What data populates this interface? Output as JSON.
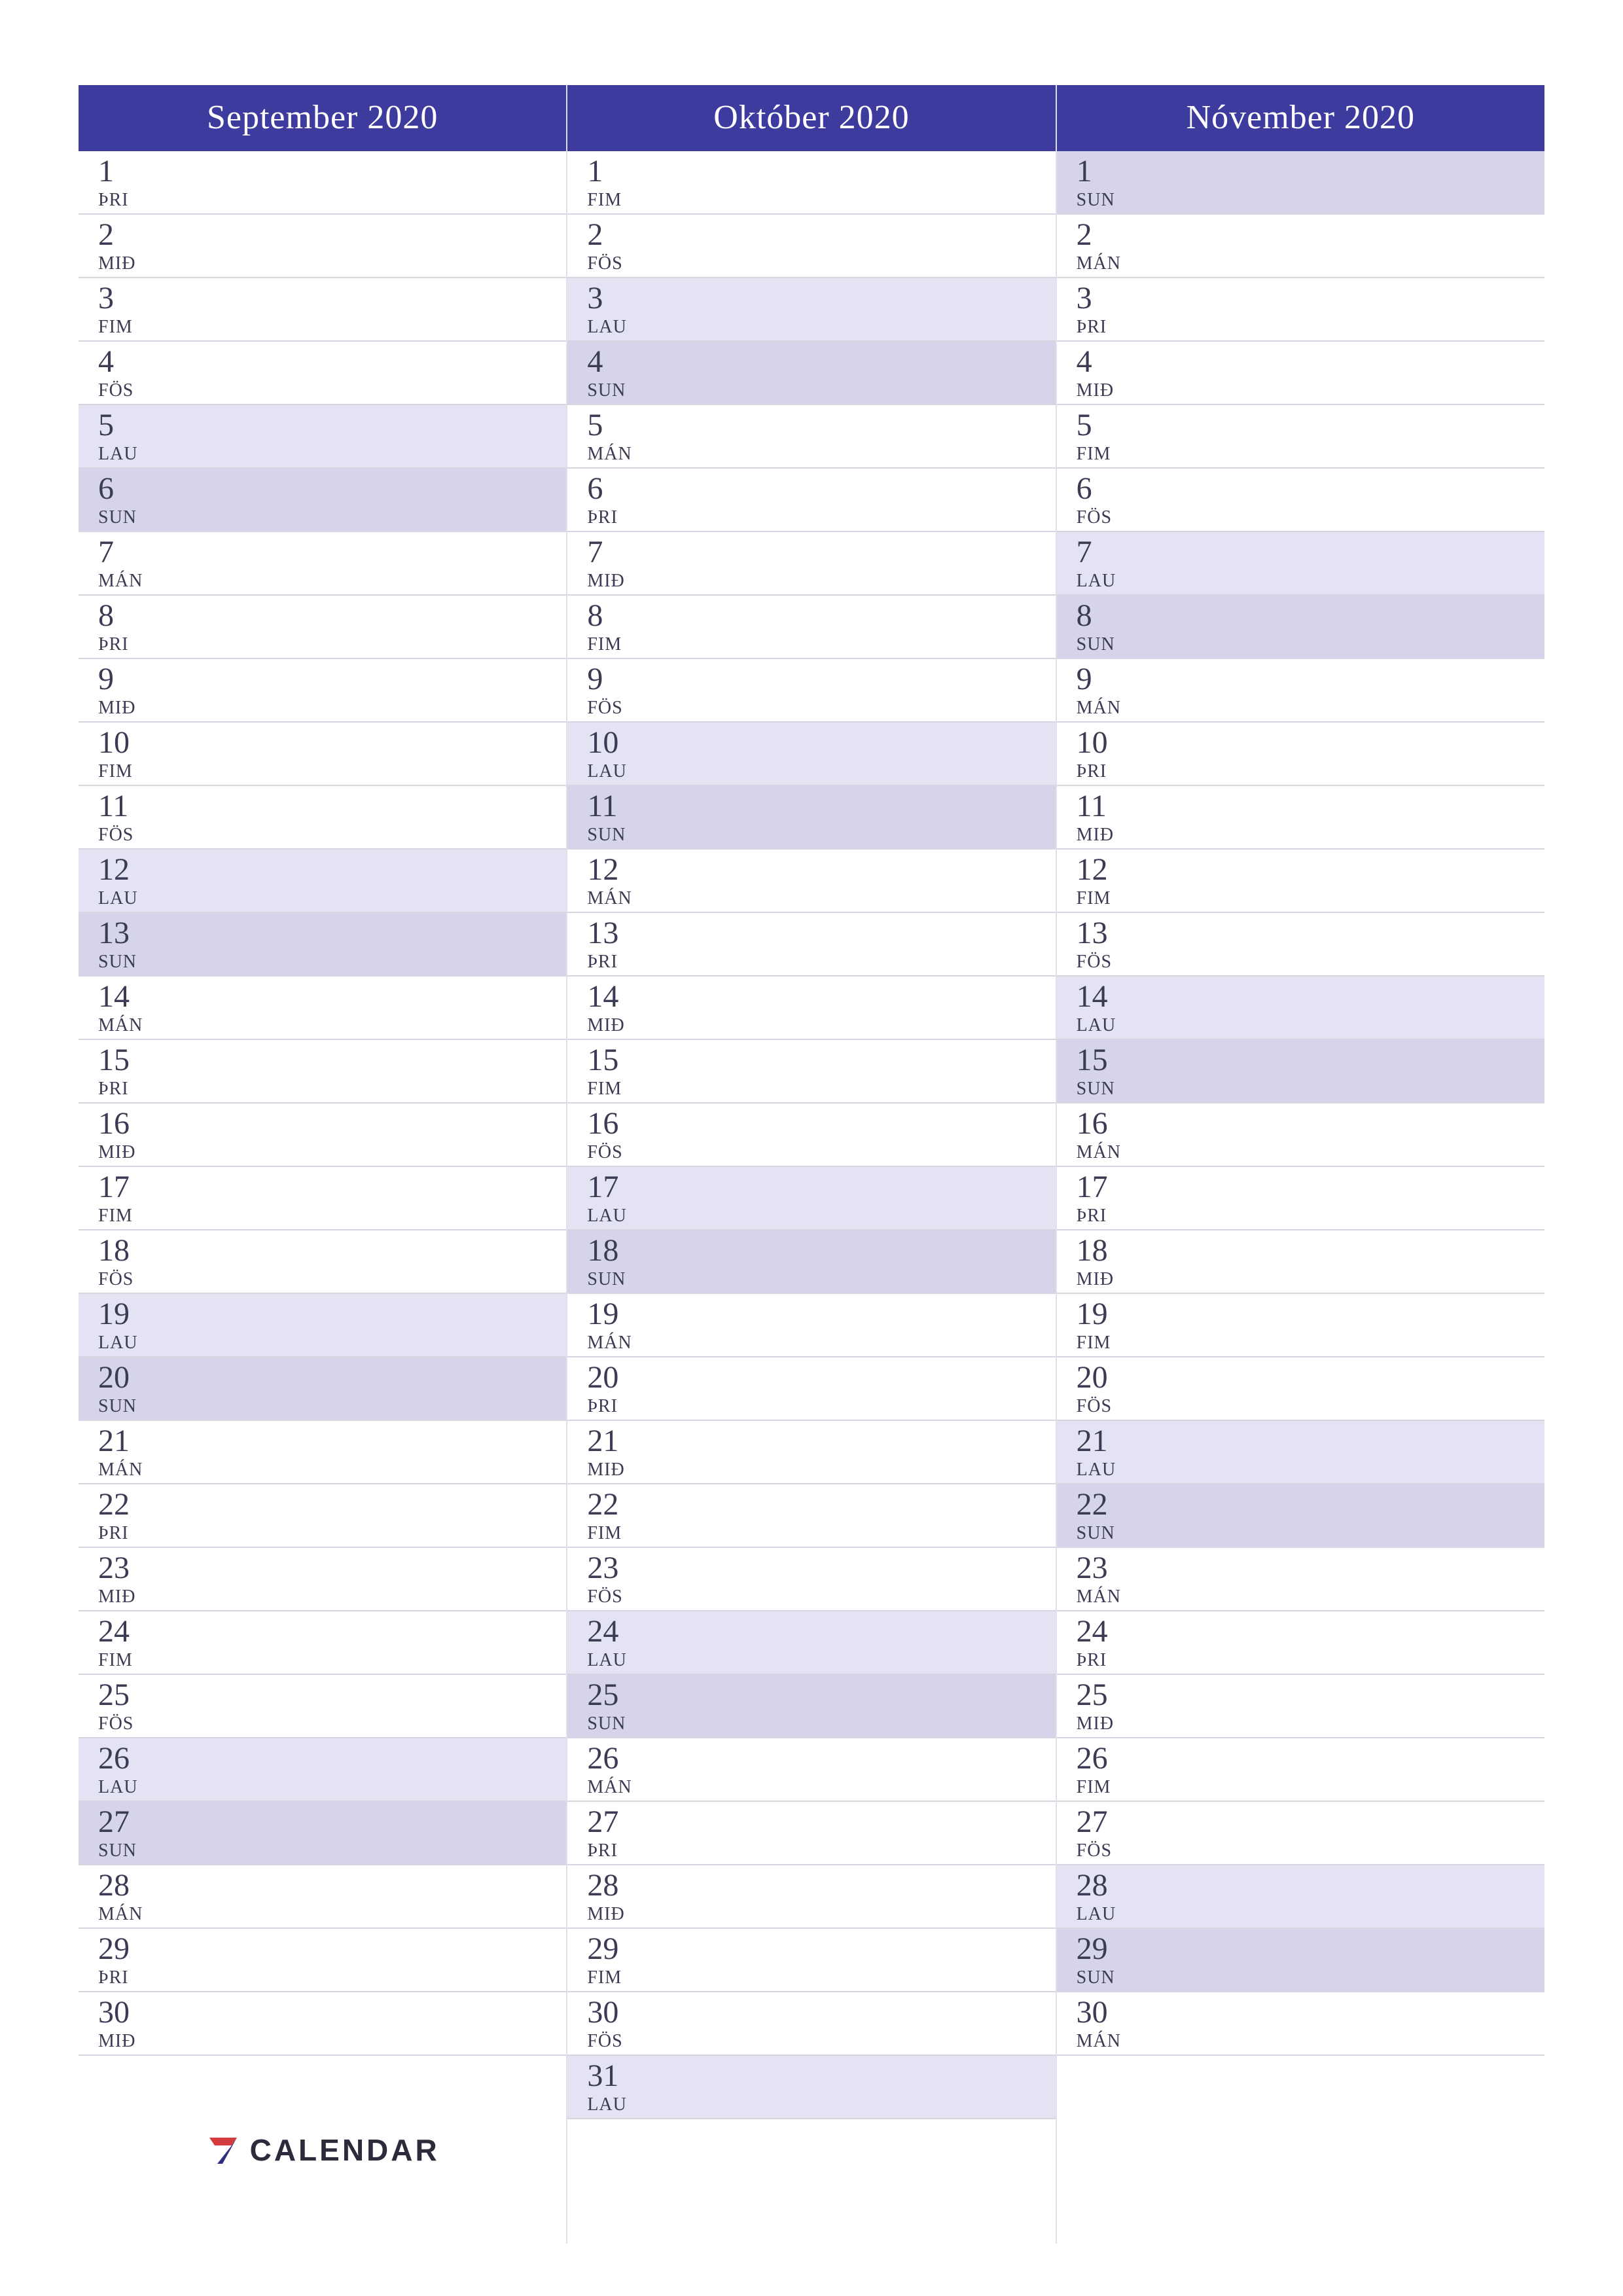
{
  "dayAbbr": {
    "MAN": "MÁN",
    "THRI": "ÞRI",
    "MID": "MIÐ",
    "FIM": "FIM",
    "FOS": "FÖS",
    "LAU": "LAU",
    "SUN": "SUN"
  },
  "brand": {
    "text": "CALENDAR"
  },
  "columns": [
    {
      "title": "September 2020",
      "days": [
        {
          "n": 1,
          "d": "THRI",
          "t": "weekday"
        },
        {
          "n": 2,
          "d": "MID",
          "t": "weekday"
        },
        {
          "n": 3,
          "d": "FIM",
          "t": "weekday"
        },
        {
          "n": 4,
          "d": "FOS",
          "t": "weekday"
        },
        {
          "n": 5,
          "d": "LAU",
          "t": "sat"
        },
        {
          "n": 6,
          "d": "SUN",
          "t": "sun"
        },
        {
          "n": 7,
          "d": "MAN",
          "t": "weekday"
        },
        {
          "n": 8,
          "d": "THRI",
          "t": "weekday"
        },
        {
          "n": 9,
          "d": "MID",
          "t": "weekday"
        },
        {
          "n": 10,
          "d": "FIM",
          "t": "weekday"
        },
        {
          "n": 11,
          "d": "FOS",
          "t": "weekday"
        },
        {
          "n": 12,
          "d": "LAU",
          "t": "sat"
        },
        {
          "n": 13,
          "d": "SUN",
          "t": "sun"
        },
        {
          "n": 14,
          "d": "MAN",
          "t": "weekday"
        },
        {
          "n": 15,
          "d": "THRI",
          "t": "weekday"
        },
        {
          "n": 16,
          "d": "MID",
          "t": "weekday"
        },
        {
          "n": 17,
          "d": "FIM",
          "t": "weekday"
        },
        {
          "n": 18,
          "d": "FOS",
          "t": "weekday"
        },
        {
          "n": 19,
          "d": "LAU",
          "t": "sat"
        },
        {
          "n": 20,
          "d": "SUN",
          "t": "sun"
        },
        {
          "n": 21,
          "d": "MAN",
          "t": "weekday"
        },
        {
          "n": 22,
          "d": "THRI",
          "t": "weekday"
        },
        {
          "n": 23,
          "d": "MID",
          "t": "weekday"
        },
        {
          "n": 24,
          "d": "FIM",
          "t": "weekday"
        },
        {
          "n": 25,
          "d": "FOS",
          "t": "weekday"
        },
        {
          "n": 26,
          "d": "LAU",
          "t": "sat"
        },
        {
          "n": 27,
          "d": "SUN",
          "t": "sun"
        },
        {
          "n": 28,
          "d": "MAN",
          "t": "weekday"
        },
        {
          "n": 29,
          "d": "THRI",
          "t": "weekday"
        },
        {
          "n": 30,
          "d": "MID",
          "t": "weekday"
        }
      ],
      "padRows": 1,
      "hasLogo": true
    },
    {
      "title": "Október 2020",
      "days": [
        {
          "n": 1,
          "d": "FIM",
          "t": "weekday"
        },
        {
          "n": 2,
          "d": "FOS",
          "t": "weekday"
        },
        {
          "n": 3,
          "d": "LAU",
          "t": "sat"
        },
        {
          "n": 4,
          "d": "SUN",
          "t": "sun"
        },
        {
          "n": 5,
          "d": "MAN",
          "t": "weekday"
        },
        {
          "n": 6,
          "d": "THRI",
          "t": "weekday"
        },
        {
          "n": 7,
          "d": "MID",
          "t": "weekday"
        },
        {
          "n": 8,
          "d": "FIM",
          "t": "weekday"
        },
        {
          "n": 9,
          "d": "FOS",
          "t": "weekday"
        },
        {
          "n": 10,
          "d": "LAU",
          "t": "sat"
        },
        {
          "n": 11,
          "d": "SUN",
          "t": "sun"
        },
        {
          "n": 12,
          "d": "MAN",
          "t": "weekday"
        },
        {
          "n": 13,
          "d": "THRI",
          "t": "weekday"
        },
        {
          "n": 14,
          "d": "MID",
          "t": "weekday"
        },
        {
          "n": 15,
          "d": "FIM",
          "t": "weekday"
        },
        {
          "n": 16,
          "d": "FOS",
          "t": "weekday"
        },
        {
          "n": 17,
          "d": "LAU",
          "t": "sat"
        },
        {
          "n": 18,
          "d": "SUN",
          "t": "sun"
        },
        {
          "n": 19,
          "d": "MAN",
          "t": "weekday"
        },
        {
          "n": 20,
          "d": "THRI",
          "t": "weekday"
        },
        {
          "n": 21,
          "d": "MID",
          "t": "weekday"
        },
        {
          "n": 22,
          "d": "FIM",
          "t": "weekday"
        },
        {
          "n": 23,
          "d": "FOS",
          "t": "weekday"
        },
        {
          "n": 24,
          "d": "LAU",
          "t": "sat"
        },
        {
          "n": 25,
          "d": "SUN",
          "t": "sun"
        },
        {
          "n": 26,
          "d": "MAN",
          "t": "weekday"
        },
        {
          "n": 27,
          "d": "THRI",
          "t": "weekday"
        },
        {
          "n": 28,
          "d": "MID",
          "t": "weekday"
        },
        {
          "n": 29,
          "d": "FIM",
          "t": "weekday"
        },
        {
          "n": 30,
          "d": "FOS",
          "t": "weekday"
        },
        {
          "n": 31,
          "d": "LAU",
          "t": "sat"
        }
      ],
      "padRows": 0,
      "hasLogo": false
    },
    {
      "title": "Nóvember 2020",
      "days": [
        {
          "n": 1,
          "d": "SUN",
          "t": "sun"
        },
        {
          "n": 2,
          "d": "MAN",
          "t": "weekday"
        },
        {
          "n": 3,
          "d": "THRI",
          "t": "weekday"
        },
        {
          "n": 4,
          "d": "MID",
          "t": "weekday"
        },
        {
          "n": 5,
          "d": "FIM",
          "t": "weekday"
        },
        {
          "n": 6,
          "d": "FOS",
          "t": "weekday"
        },
        {
          "n": 7,
          "d": "LAU",
          "t": "sat"
        },
        {
          "n": 8,
          "d": "SUN",
          "t": "sun"
        },
        {
          "n": 9,
          "d": "MAN",
          "t": "weekday"
        },
        {
          "n": 10,
          "d": "THRI",
          "t": "weekday"
        },
        {
          "n": 11,
          "d": "MID",
          "t": "weekday"
        },
        {
          "n": 12,
          "d": "FIM",
          "t": "weekday"
        },
        {
          "n": 13,
          "d": "FOS",
          "t": "weekday"
        },
        {
          "n": 14,
          "d": "LAU",
          "t": "sat"
        },
        {
          "n": 15,
          "d": "SUN",
          "t": "sun"
        },
        {
          "n": 16,
          "d": "MAN",
          "t": "weekday"
        },
        {
          "n": 17,
          "d": "THRI",
          "t": "weekday"
        },
        {
          "n": 18,
          "d": "MID",
          "t": "weekday"
        },
        {
          "n": 19,
          "d": "FIM",
          "t": "weekday"
        },
        {
          "n": 20,
          "d": "FOS",
          "t": "weekday"
        },
        {
          "n": 21,
          "d": "LAU",
          "t": "sat"
        },
        {
          "n": 22,
          "d": "SUN",
          "t": "sun"
        },
        {
          "n": 23,
          "d": "MAN",
          "t": "weekday"
        },
        {
          "n": 24,
          "d": "THRI",
          "t": "weekday"
        },
        {
          "n": 25,
          "d": "MID",
          "t": "weekday"
        },
        {
          "n": 26,
          "d": "FIM",
          "t": "weekday"
        },
        {
          "n": 27,
          "d": "FOS",
          "t": "weekday"
        },
        {
          "n": 28,
          "d": "LAU",
          "t": "sat"
        },
        {
          "n": 29,
          "d": "SUN",
          "t": "sun"
        },
        {
          "n": 30,
          "d": "MAN",
          "t": "weekday"
        }
      ],
      "padRows": 1,
      "hasLogo": false
    }
  ]
}
